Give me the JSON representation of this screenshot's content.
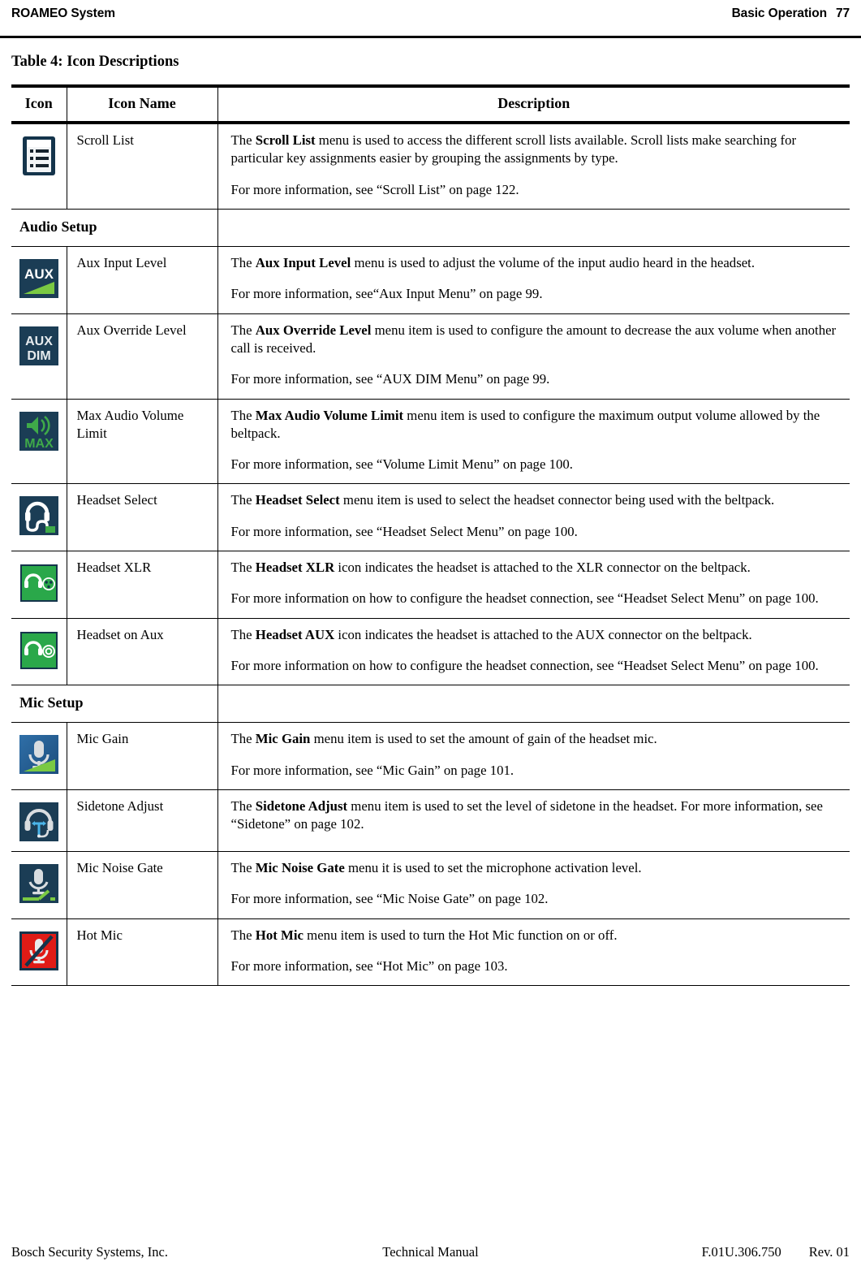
{
  "header": {
    "left": "ROAMEO System",
    "section": "Basic Operation",
    "page_number": "77"
  },
  "table": {
    "caption": "Table 4: Icon Descriptions",
    "columns": {
      "icon": "Icon",
      "name": "Icon Name",
      "description": "Description"
    },
    "rows": [
      {
        "kind": "row",
        "icon": "scroll-list-icon",
        "name": "Scroll List",
        "paragraphs": [
          {
            "lead": "The ",
            "bold": "Scroll List",
            "rest": " menu is used to access the different scroll lists available. Scroll lists make searching for particular key assignments easier by grouping the assignments by type."
          },
          {
            "lead": "",
            "bold": "",
            "rest": "For more information, see “Scroll List” on page 122."
          }
        ]
      },
      {
        "kind": "section",
        "label": "Audio Setup"
      },
      {
        "kind": "row",
        "icon": "aux-input-level-icon",
        "name": "Aux Input Level",
        "paragraphs": [
          {
            "lead": "The ",
            "bold": "Aux Input Level",
            "rest": " menu is used to adjust the volume of the input audio heard in the headset."
          },
          {
            "lead": "",
            "bold": "",
            "rest": "For more information, see“Aux Input Menu” on page 99."
          }
        ]
      },
      {
        "kind": "row",
        "icon": "aux-dim-icon",
        "name": "Aux Override Level",
        "paragraphs": [
          {
            "lead": "The ",
            "bold": "Aux Override Level",
            "rest": " menu item is used to configure the amount to decrease the aux volume when another call is received."
          },
          {
            "lead": "",
            "bold": "",
            "rest": "For more information, see “AUX DIM Menu” on page 99."
          }
        ]
      },
      {
        "kind": "row",
        "icon": "max-volume-icon",
        "name": "Max Audio Volume Limit",
        "paragraphs": [
          {
            "lead": "The ",
            "bold": "Max Audio Volume Limit",
            "rest": " menu item is used to configure the maximum output volume allowed by the beltpack."
          },
          {
            "lead": "",
            "bold": "",
            "rest": "For more information, see “Volume Limit Menu” on page 100."
          }
        ]
      },
      {
        "kind": "row",
        "icon": "headset-select-icon",
        "name": "Headset Select",
        "paragraphs": [
          {
            "lead": "The ",
            "bold": "Headset Select",
            "rest": " menu item is used to select the headset connector being used with the beltpack."
          },
          {
            "lead": "",
            "bold": "",
            "rest": "For more information, see “Headset Select Menu” on page 100."
          }
        ]
      },
      {
        "kind": "row",
        "icon": "headset-xlr-icon",
        "name": "Headset XLR",
        "paragraphs": [
          {
            "lead": "The ",
            "bold": "Headset XLR",
            "rest": " icon indicates the headset is attached to the XLR connector on the beltpack."
          },
          {
            "lead": "",
            "bold": "",
            "rest": "For more information on how to configure the headset connection, see “Headset Select Menu” on page 100."
          }
        ]
      },
      {
        "kind": "row",
        "icon": "headset-aux-icon",
        "name": "Headset on Aux",
        "paragraphs": [
          {
            "lead": "The ",
            "bold": "Headset AUX",
            "rest": " icon indicates the headset is attached to the AUX connector on the beltpack."
          },
          {
            "lead": "",
            "bold": "",
            "rest": "For more information on how to configure the headset connection, see “Headset Select Menu” on page 100."
          }
        ]
      },
      {
        "kind": "section",
        "label": "Mic Setup"
      },
      {
        "kind": "row",
        "icon": "mic-gain-icon",
        "name": "Mic Gain",
        "paragraphs": [
          {
            "lead": "The ",
            "bold": "Mic Gain",
            "rest": " menu item is used to set the amount of gain of the headset mic."
          },
          {
            "lead": "",
            "bold": "",
            "rest": "For more information, see “Mic Gain” on page 101."
          }
        ]
      },
      {
        "kind": "row",
        "icon": "sidetone-adjust-icon",
        "name": "Sidetone Adjust",
        "paragraphs": [
          {
            "lead": "The ",
            "bold": "Sidetone Adjust",
            "rest": " menu item is used to set the level of sidetone in the headset. For more information, see “Sidetone” on page 102."
          }
        ]
      },
      {
        "kind": "row",
        "icon": "mic-noise-gate-icon",
        "name": "Mic Noise Gate",
        "paragraphs": [
          {
            "lead": "The ",
            "bold": "Mic Noise Gate",
            "rest": " menu it is used to set the microphone activation level."
          },
          {
            "lead": "",
            "bold": "",
            "rest": "For more information, see “Mic Noise Gate” on page 102."
          }
        ]
      },
      {
        "kind": "row",
        "icon": "hot-mic-icon",
        "name": "Hot Mic",
        "paragraphs": [
          {
            "lead": "The ",
            "bold": "Hot Mic",
            "rest": " menu item is used to turn the Hot Mic function on or off."
          },
          {
            "lead": "",
            "bold": "",
            "rest": "For more information, see “Hot Mic” on page 103."
          }
        ]
      }
    ]
  },
  "footer": {
    "company": "Bosch Security Systems, Inc.",
    "doc_type": "Technical Manual",
    "doc_number": "F.01U.306.750",
    "revision": "Rev. 01"
  },
  "colors": {
    "icon_navy": "#1b3d55",
    "icon_navy_dark": "#14344b",
    "icon_green": "#3faa49",
    "icon_green_light": "#7ac943",
    "icon_red": "#e01b16",
    "icon_blue": "#2e6da4",
    "icon_silver": "#d9dde0"
  }
}
